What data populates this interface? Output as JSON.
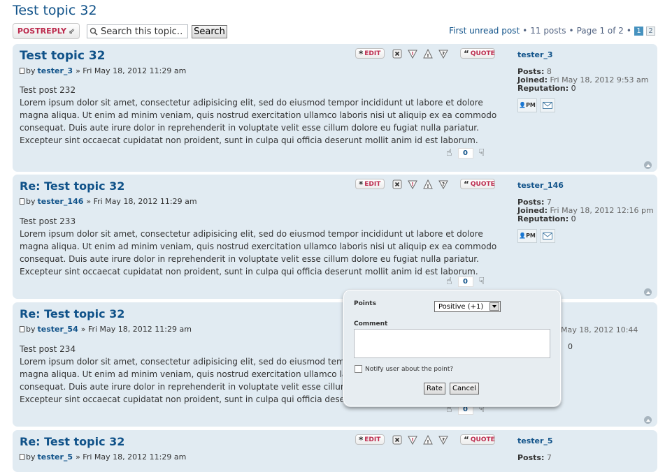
{
  "page_title": "Test topic 32",
  "toolbar": {
    "postreply_label": "POSTREPLY",
    "search_placeholder": "Search this topic…",
    "search_value": "Search this topic…",
    "search_button": "Search"
  },
  "pagination": {
    "first_unread": "First unread post",
    "bullet": "•",
    "posts_count": "11 posts",
    "page_info": "Page 1 of 2",
    "pages": [
      "1",
      "2"
    ]
  },
  "post_actions": {
    "edit": "EDIT",
    "quote": "QUOTE"
  },
  "profile_labels": {
    "posts": "Posts:",
    "joined": "Joined:",
    "reputation": "Reputation:",
    "pm": "PM"
  },
  "posts": [
    {
      "title": "Test topic 32",
      "by": "by",
      "author": "tester_3",
      "date": "» Fri May 18, 2012 11:29 am",
      "body_first": "Test post 232",
      "body": "Lorem ipsum dolor sit amet, consectetur adipisicing elit, sed do eiusmod tempor incididunt ut labore et dolore magna aliqua. Ut enim ad minim veniam, quis nostrud exercitation ullamco laboris nisi ut aliquip ex ea commodo consequat. Duis aute irure dolor in reprehenderit in voluptate velit esse cillum dolore eu fugiat nulla pariatur. Excepteur sint occaecat cupidatat non proident, sunt in culpa qui officia deserunt mollit anim id est laborum.",
      "rating": "0",
      "profile": {
        "username": "tester_3",
        "posts": "8",
        "joined": "Fri May 18, 2012 9:53 am",
        "reputation": "0"
      }
    },
    {
      "title": "Re: Test topic 32",
      "by": "by",
      "author": "tester_146",
      "date": "» Fri May 18, 2012 11:29 am",
      "body_first": "Test post 233",
      "body": "Lorem ipsum dolor sit amet, consectetur adipisicing elit, sed do eiusmod tempor incididunt ut labore et dolore magna aliqua. Ut enim ad minim veniam, quis nostrud exercitation ullamco laboris nisi ut aliquip ex ea commodo consequat. Duis aute irure dolor in reprehenderit in voluptate velit esse cillum dolore eu fugiat nulla pariatur. Excepteur sint occaecat cupidatat non proident, sunt in culpa qui officia deserunt mollit anim id est laborum.",
      "rating": "0",
      "profile": {
        "username": "tester_146",
        "posts": "7",
        "joined": "Fri May 18, 2012 12:16 pm",
        "reputation": "0"
      }
    },
    {
      "title": "Re: Test topic 32",
      "by": "by",
      "author": "tester_54",
      "date": "» Fri May 18, 2012 11:29 am",
      "body_first": "Test post 234",
      "body": "Lorem ipsum dolor sit amet, consectetur adipisicing elit, sed do eiusmod tempor incididunt ut labore et dolore magna aliqua. Ut enim ad minim veniam, quis nostrud exercitation ullamco laboris nisi ut aliquip ex ea commodo consequat. Duis aute irure dolor in reprehenderit in voluptate velit esse cillum dolore eu fugiat nulla pariatur. Excepteur sint occaecat cupidatat non proident, sunt in culpa qui officia deserunt mollit anim id est laborum.",
      "rating": "0",
      "profile": {
        "username": "tester_54",
        "joined_partial": "May 18, 2012 10:44",
        "reputation_partial": "0"
      }
    },
    {
      "title": "Re: Test topic 32",
      "by": "by",
      "author": "tester_5",
      "date": "» Fri May 18, 2012 11:29 am",
      "profile": {
        "username": "tester_5",
        "posts": "7"
      }
    }
  ],
  "rate_popup": {
    "points_label": "Points",
    "points_value": "Positive (+1)",
    "comment_label": "Comment",
    "notify_label": "Notify user about the point?",
    "rate_button": "Rate",
    "cancel_button": "Cancel"
  },
  "colors": {
    "link": "#105289",
    "post_bg": "#e1ebf2",
    "accent_red": "#bc2a4d"
  }
}
